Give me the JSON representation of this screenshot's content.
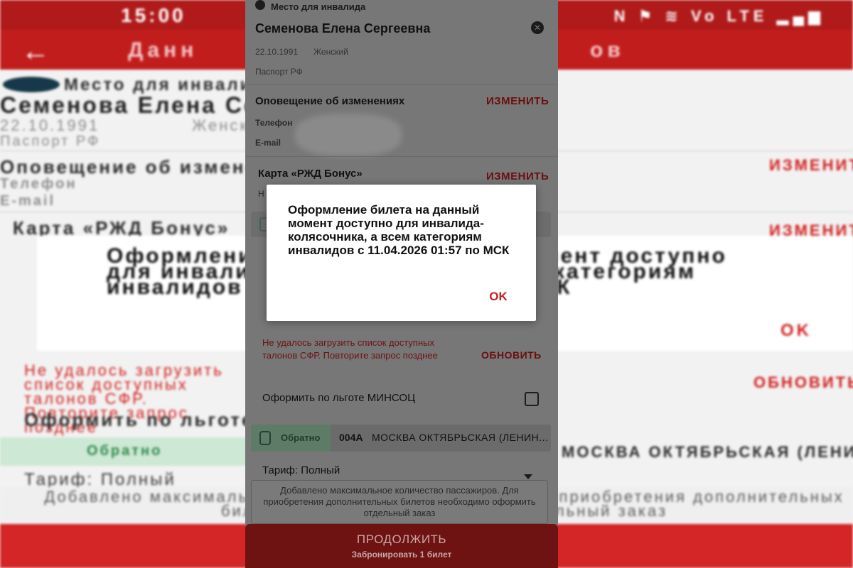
{
  "status_bar": {
    "time": "15:00",
    "icons": "N ⚑ ≋ Vo LTE ▂▄▆"
  },
  "app_bar": {
    "back_icon": "arrow-left-icon",
    "title_fragment_left": "Данн",
    "title_fragment_right": "ов"
  },
  "passenger": {
    "seat_type": "Место для инвалида",
    "name": "Семенова Елена Сергеевна",
    "birth_date": "22.10.1991",
    "gender": "Женский",
    "document": "Паспорт РФ"
  },
  "notification": {
    "title": "Оповещение об изменениях",
    "change_label": "ИЗМЕНИТЬ",
    "phone_label": "Телефон",
    "email_label": "E-mail"
  },
  "bonus_card": {
    "title": "Карта «РЖД Бонус»",
    "change_label": "ИЗМЕНИТЬ",
    "number_label": "Н"
  },
  "sfr": {
    "error_text": "Не удалось загрузить список доступных талонов СФР. Повторите запрос позднее",
    "refresh_label": "ОБНОВИТЬ"
  },
  "mincoc": {
    "label": "Оформить по льготе МИНСОЦ",
    "checked": false
  },
  "return_trip": {
    "tag": "Обратно",
    "train": "004А",
    "station": "МОСКВА ОКТЯБРЬСКАЯ (ЛЕНИН..."
  },
  "tariff": {
    "label": "Тариф: Полный"
  },
  "footnote": "Добавлено максимальное количество пассажиров. Для приобретения дополнительных билетов необходимо оформить отдельный заказ",
  "bottom_button": {
    "label": "ПРОДОЛЖИТЬ",
    "sublabel": "Забронировать 1 билет"
  },
  "dialog": {
    "message": "Оформление билета на данный момент доступно для инвалида-колясочника, а всем категориям инвалидов с 11.04.2026 01:57 по МСК",
    "ok_label": "OK"
  },
  "colors": {
    "accent_red": "#d3201f",
    "status_red": "#b01a1a",
    "green_tag": "#cde8d4"
  }
}
